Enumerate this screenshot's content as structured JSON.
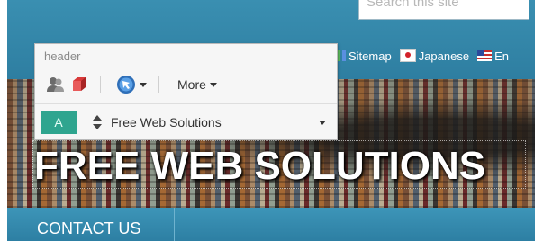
{
  "search": {
    "placeholder": "Search this site"
  },
  "top_links": [
    {
      "label": "Sitemap",
      "icon": "sitemap-icon"
    },
    {
      "label": "Japanese",
      "icon": "japan-flag-icon"
    },
    {
      "label": "En",
      "icon": "us-flag-icon"
    }
  ],
  "hero": {
    "title": "FREE WEB SOLUTIONS"
  },
  "nav": {
    "contact": "CONTACT US"
  },
  "panel": {
    "title": "header",
    "more_label": "More",
    "style_swatch": "A",
    "style_name": "Free Web Solutions"
  },
  "colors": {
    "accent": "#2fa58f",
    "site_blue": "#2e7ea1",
    "cube_red": "#d93a3a"
  }
}
